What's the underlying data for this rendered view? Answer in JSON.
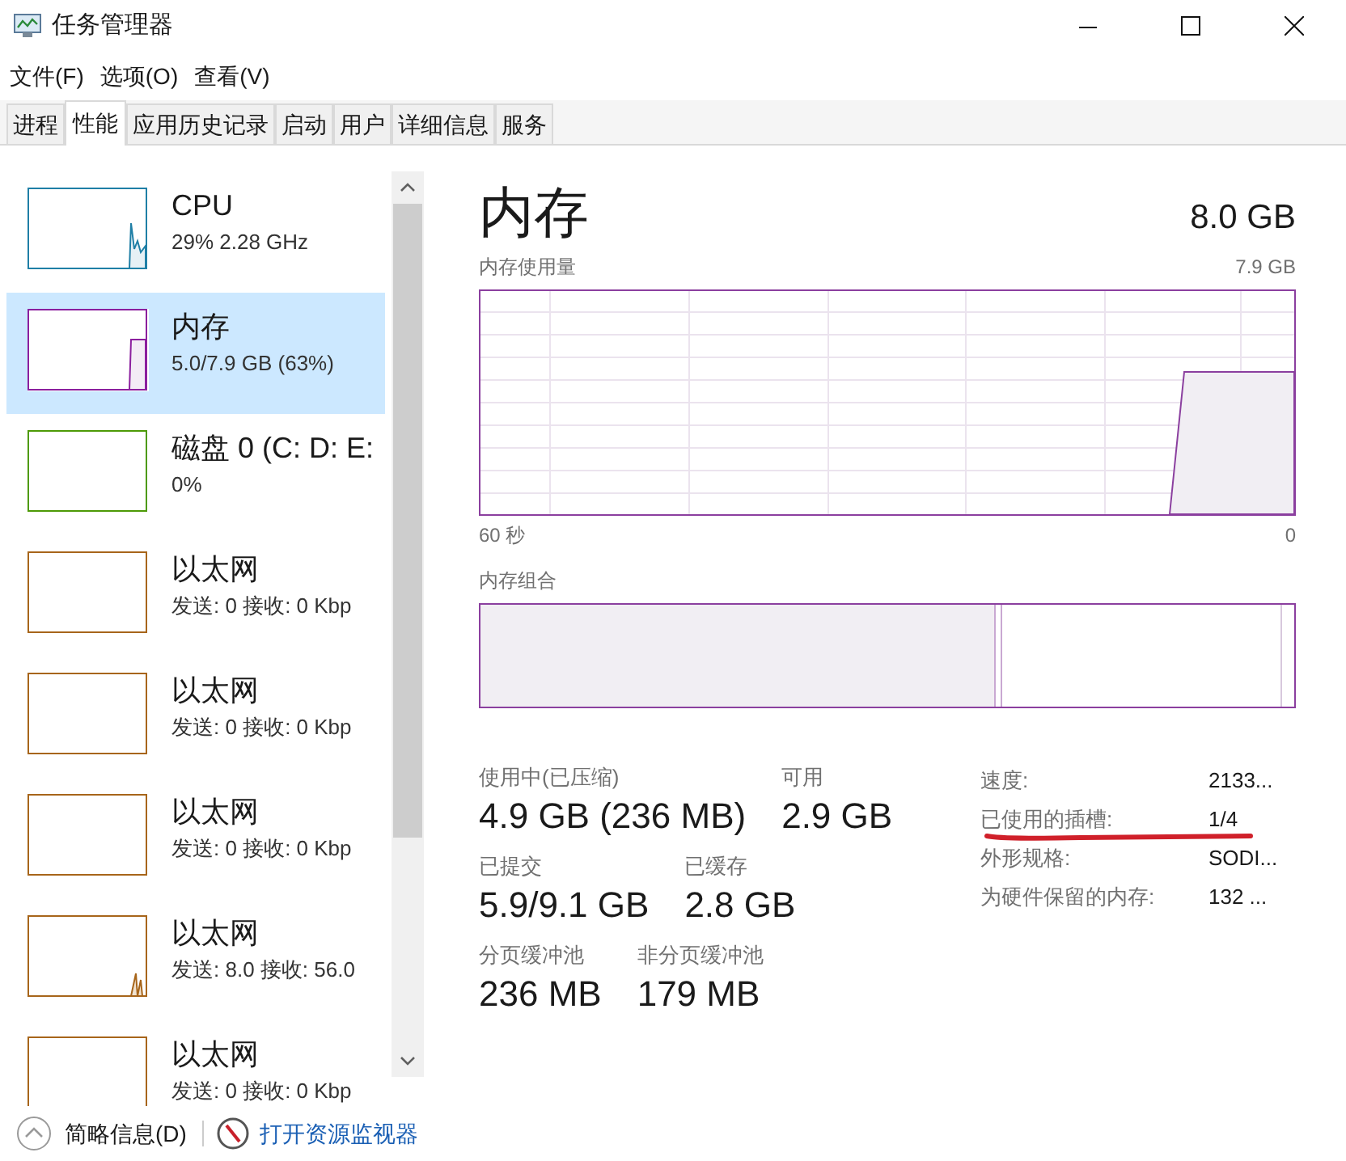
{
  "window": {
    "title": "任务管理器"
  },
  "menu": [
    "文件(F)",
    "选项(O)",
    "查看(V)"
  ],
  "tabs": [
    {
      "label": "进程",
      "selected": false
    },
    {
      "label": "性能",
      "selected": true
    },
    {
      "label": "应用历史记录",
      "selected": false
    },
    {
      "label": "启动",
      "selected": false
    },
    {
      "label": "用户",
      "selected": false
    },
    {
      "label": "详细信息",
      "selected": false
    },
    {
      "label": "服务",
      "selected": false
    }
  ],
  "sidebar": {
    "items": [
      {
        "kind": "cpu",
        "name": "CPU",
        "detail": "29% 2.28 GHz",
        "color": "#1f7fa6",
        "selected": false
      },
      {
        "kind": "memory",
        "name": "内存",
        "detail": "5.0/7.9 GB (63%)",
        "color": "#8b1f9e",
        "selected": true
      },
      {
        "kind": "idle",
        "name": "磁盘 0 (C: D: E:",
        "detail": "0%",
        "color": "#4d9a06",
        "selected": false
      },
      {
        "kind": "idle",
        "name": "以太网",
        "detail": "发送: 0 接收: 0 Kbp",
        "color": "#a7651a",
        "selected": false
      },
      {
        "kind": "idle",
        "name": "以太网",
        "detail": "发送: 0 接收: 0 Kbp",
        "color": "#a7651a",
        "selected": false
      },
      {
        "kind": "idle",
        "name": "以太网",
        "detail": "发送: 0 接收: 0 Kbp",
        "color": "#a7651a",
        "selected": false
      },
      {
        "kind": "traffic",
        "name": "以太网",
        "detail": "发送: 8.0 接收: 56.0",
        "color": "#a7651a",
        "selected": false
      },
      {
        "kind": "idle",
        "name": "以太网",
        "detail": "发送: 0 接收: 0 Kbp",
        "color": "#a7651a",
        "selected": false
      }
    ]
  },
  "panel": {
    "title": "内存",
    "total": "8.0 GB",
    "usage_label": "内存使用量",
    "usage_max": "7.9 GB",
    "axis_start": "60 秒",
    "axis_end": "0",
    "composition_label": "内存组合",
    "stats": [
      [
        {
          "label": "使用中(已压缩)",
          "value": "4.9 GB (236 MB)"
        },
        {
          "label": "可用",
          "value": "2.9 GB"
        }
      ],
      [
        {
          "label": "已提交",
          "value": "5.9/9.1 GB"
        },
        {
          "label": "已缓存",
          "value": "2.8 GB"
        }
      ],
      [
        {
          "label": "分页缓冲池",
          "value": "236 MB"
        },
        {
          "label": "非分页缓冲池",
          "value": "179 MB"
        }
      ]
    ],
    "specs": [
      {
        "kind": "plain",
        "label": "速度:",
        "value": "2133..."
      },
      {
        "kind": "underlined",
        "label": "已使用的插槽:",
        "value": "1/4"
      },
      {
        "kind": "plain",
        "label": "外形规格:",
        "value": "SODI..."
      },
      {
        "kind": "plain",
        "label": "为硬件保留的内存:",
        "value": "132 ..."
      }
    ]
  },
  "footer": {
    "summary": "简略信息(D)",
    "link": "打开资源监视器"
  }
}
